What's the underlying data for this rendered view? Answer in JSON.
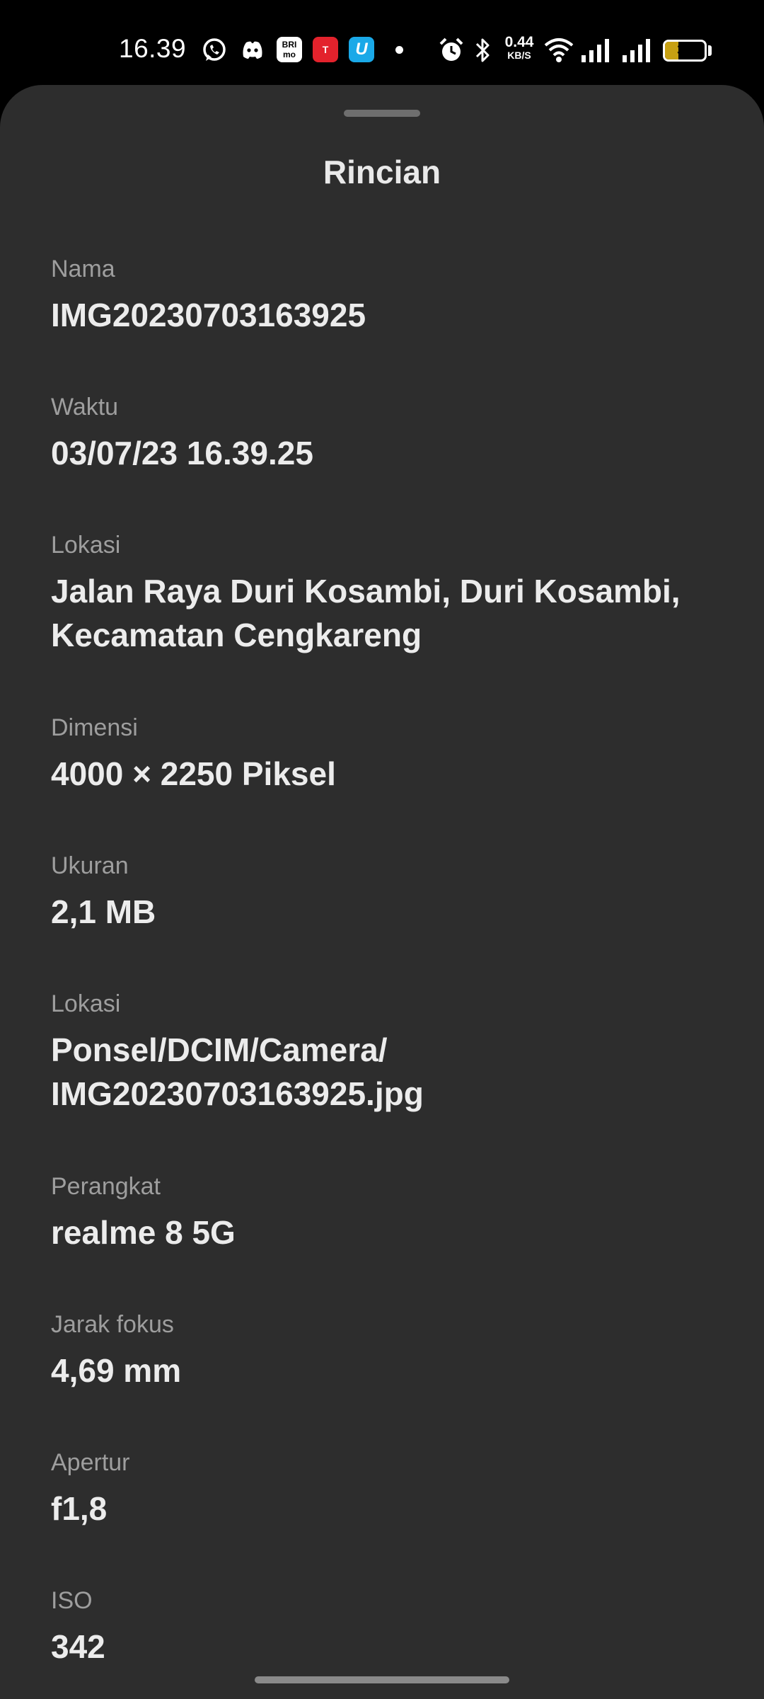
{
  "status_bar": {
    "time": "16.39",
    "app_badges": [
      "BRI mo",
      "T",
      "U"
    ],
    "net_speed_value": "0.44",
    "net_speed_unit": "KB/S",
    "battery_level": "34",
    "battery_fraction": 0.34,
    "battery_color": "#c7a012",
    "icons": [
      "whatsapp-icon",
      "discord-icon",
      "bri-mo-icon",
      "tix-icon",
      "u-app-icon",
      "dot-icon",
      "alarm-icon",
      "bluetooth-icon",
      "wifi-icon",
      "signal-icon-1",
      "signal-icon-2",
      "battery-icon"
    ]
  },
  "sheet": {
    "title": "Rincian",
    "details": [
      {
        "label": "Nama",
        "value": "IMG20230703163925"
      },
      {
        "label": "Waktu",
        "value": "03/07/23 16.39.25"
      },
      {
        "label": "Lokasi",
        "value": "Jalan Raya Duri Kosambi, Duri Kosambi, Kecamatan Cengkareng"
      },
      {
        "label": "Dimensi",
        "value": "4000 × 2250 Piksel"
      },
      {
        "label": "Ukuran",
        "value": "2,1 MB"
      },
      {
        "label": "Lokasi",
        "value": "Ponsel/DCIM/Camera/ IMG20230703163925.jpg"
      },
      {
        "label": "Perangkat",
        "value": "realme 8 5G"
      },
      {
        "label": "Jarak fokus",
        "value": "4,69 mm"
      },
      {
        "label": "Apertur",
        "value": "f1,8"
      },
      {
        "label": "ISO",
        "value": "342"
      }
    ]
  },
  "colors": {
    "sheet_background": "#2d2d2d",
    "label_text": "#9e9e9e",
    "value_text": "#ececec"
  }
}
